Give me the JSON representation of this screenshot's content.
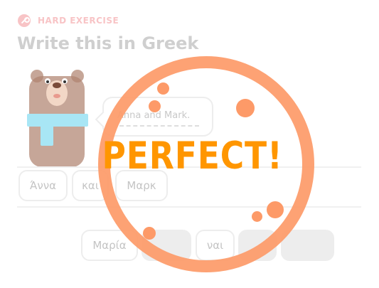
{
  "header": {
    "badge_icon": "dumbbell-icon",
    "badge_label": "HARD EXERCISE",
    "title": "Write this in Greek"
  },
  "prompt": {
    "sentence": "Anna and Mark."
  },
  "answer_chips": [
    {
      "label": "Άννα"
    },
    {
      "label": "και"
    },
    {
      "label": "Μαρκ"
    }
  ],
  "word_bank": [
    {
      "label": "Μαρία",
      "used": false
    },
    {
      "label": "",
      "used": true
    },
    {
      "label": "ναι",
      "used": false
    },
    {
      "label": "",
      "used": true
    },
    {
      "label": "",
      "used": true
    }
  ],
  "overlay": {
    "text": "PERFECT!"
  },
  "colors": {
    "accent_orange": "#ff9600",
    "stamp_orange": "#fd9a68",
    "badge_pink": "#f8c4c6",
    "bear_brown": "#b08470",
    "scarf_blue": "#a8e6f5"
  }
}
